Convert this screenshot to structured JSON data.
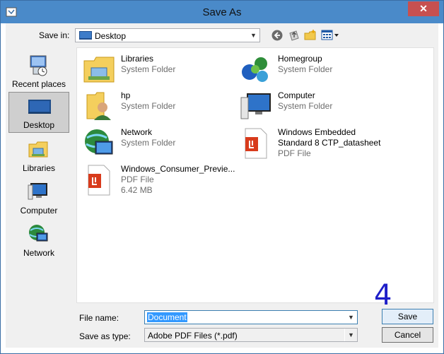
{
  "window": {
    "title": "Save As",
    "close_glyph": "✕"
  },
  "toolbar": {
    "save_in_label": "Save in:",
    "save_in_value": "Desktop",
    "icons": [
      "back-icon",
      "up-folder-icon",
      "new-folder-icon",
      "view-menu-icon"
    ]
  },
  "places": [
    {
      "label": "Recent places",
      "icon": "recent-places-icon",
      "selected": false
    },
    {
      "label": "Desktop",
      "icon": "desktop-icon",
      "selected": true
    },
    {
      "label": "Libraries",
      "icon": "libraries-icon",
      "selected": false
    },
    {
      "label": "Computer",
      "icon": "computer-icon",
      "selected": false
    },
    {
      "label": "Network",
      "icon": "network-icon",
      "selected": false
    }
  ],
  "items": [
    {
      "name": "Libraries",
      "line2": "System Folder",
      "line3": "",
      "icon": "libraries-folder-icon"
    },
    {
      "name": "Homegroup",
      "line2": "System Folder",
      "line3": "",
      "icon": "homegroup-icon"
    },
    {
      "name": "hp",
      "line2": "System Folder",
      "line3": "",
      "icon": "user-folder-icon"
    },
    {
      "name": "Computer",
      "line2": "System Folder",
      "line3": "",
      "icon": "computer-icon"
    },
    {
      "name": "Network",
      "line2": "System Folder",
      "line3": "",
      "icon": "network-globe-icon"
    },
    {
      "name": "Windows Embedded",
      "line2": "Standard 8 CTP_datasheet",
      "line3": "PDF File",
      "icon": "pdf-file-icon"
    },
    {
      "name": "Windows_Consumer_Previe...",
      "line2": "PDF File",
      "line3": "6.42 MB",
      "icon": "pdf-file-icon"
    }
  ],
  "form": {
    "file_name_label": "File name:",
    "file_name_value": "Document",
    "save_type_label": "Save as type:",
    "save_type_value": "Adobe PDF Files (*.pdf)"
  },
  "buttons": {
    "save": "Save",
    "cancel": "Cancel"
  },
  "annotation": "4",
  "colors": {
    "titlebar": "#4a8ac9",
    "close": "#c75050",
    "selection": "#3399ff",
    "annotation": "#1e1ec8"
  }
}
